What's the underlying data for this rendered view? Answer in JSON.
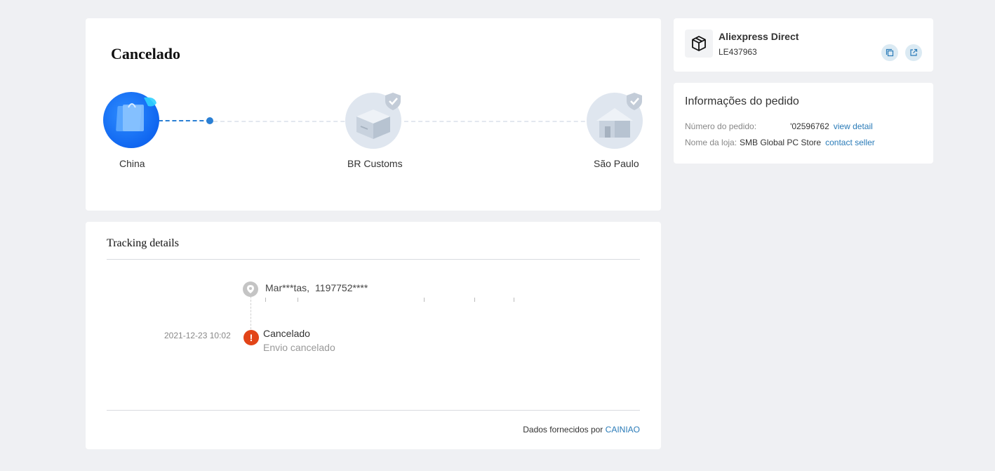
{
  "status": {
    "title": "Cancelado",
    "stages": [
      {
        "label": "China",
        "state": "done"
      },
      {
        "label": "BR Customs",
        "state": "pending"
      },
      {
        "label": "São Paulo",
        "state": "pending"
      }
    ]
  },
  "tracking": {
    "title": "Tracking details",
    "address": {
      "name": "Mar***tas,",
      "phone": "1197752****"
    },
    "events": [
      {
        "time": "2021-12-23 10:02",
        "title": "Cancelado",
        "subtitle": "Envio cancelado"
      }
    ],
    "provider": {
      "prefix": "Dados fornecidos por",
      "name": "CAINIAO"
    }
  },
  "carrier": {
    "name": "Aliexpress Direct",
    "code": "LE437963",
    "icon": "package-icon",
    "actions": [
      {
        "name": "copy",
        "icon": "copy-icon"
      },
      {
        "name": "open",
        "icon": "external-link-icon"
      }
    ]
  },
  "order": {
    "title": "Informações do pedido",
    "number_label": "Número do pedido:",
    "number_value": "'02596762",
    "view_detail": "view detail",
    "store_label": "Nome da loja:",
    "store_value": "SMB Global PC Store",
    "contact_seller": "contact seller"
  },
  "colors": {
    "background": "#eff0f3",
    "accent": "#2a7fd4",
    "link": "#2a7bb8",
    "alert": "#e24418"
  }
}
